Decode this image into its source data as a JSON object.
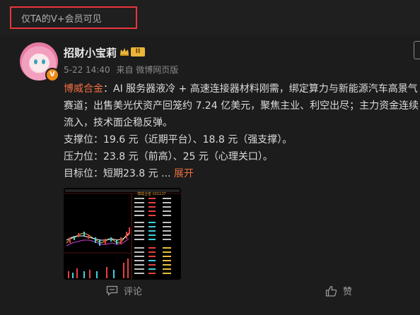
{
  "vip_banner": {
    "text": "仅TA的V+会员可见"
  },
  "post": {
    "username": "招财小宝莉",
    "avatar_badge": "V",
    "level_badge": "II",
    "date": "5-22 14:40",
    "source": "来自 微博网页版",
    "lines": [
      {
        "highlight": "博威合金",
        "text": "：AI 服务器液冷 + 高速连接器材料刚需，绑定算力与新能源汽车高景气"
      },
      {
        "text": "赛道；出售美光伏资产回笼约 7.24 亿美元，聚焦主业、利空出尽；主力资金连续"
      },
      {
        "text": "流入，技术面企稳反弹。"
      },
      {
        "text": "支撑位：19.6 元（近期平台）、18.8 元（强支撑）。"
      },
      {
        "text": "压力位：23.8 元（前高）、25 元（心理关口）。"
      },
      {
        "text": "目标位：短期23.8 元 ...",
        "expand": "展开"
      }
    ],
    "image_title": "博威合金 601137"
  },
  "actions": {
    "comment": "评论",
    "like": "赞"
  },
  "colors": {
    "accent": "#ef6e42",
    "banner_border": "#e8363a",
    "level_gold": "#e9b53a"
  }
}
